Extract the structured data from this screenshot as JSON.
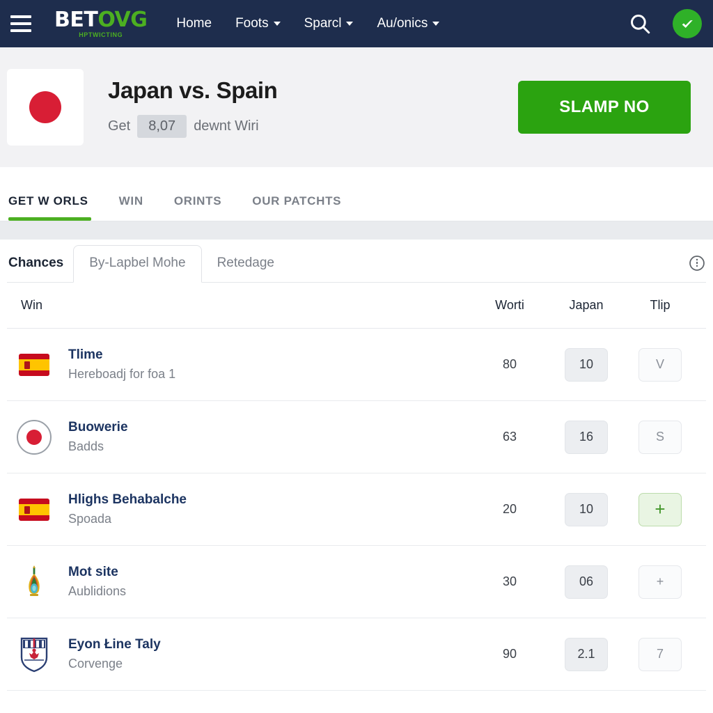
{
  "header": {
    "menu_icon": "hamburger-icon",
    "logo": {
      "primary": "BET",
      "accent": "OVG",
      "tagline": "HPTWICTING"
    },
    "nav": [
      {
        "label": "Home",
        "has_caret": false
      },
      {
        "label": "Foots",
        "has_caret": true
      },
      {
        "label": "Sparcl",
        "has_caret": true
      },
      {
        "label": "Au/onics",
        "has_caret": true
      }
    ],
    "search_icon": "search-icon",
    "avatar_icon": "avatar-check-icon",
    "background": "#1e2d4d"
  },
  "hero": {
    "flag_icon": "japan-flag-icon",
    "title": "Japan vs. Spain",
    "subtitle_prefix": "Get",
    "subtitle_chip": "8,07",
    "subtitle_suffix": "dewnt Wiri",
    "cta_label": "SLAMP NO",
    "cta_color": "#2ba310",
    "background": "#f2f2f4"
  },
  "tabs": [
    {
      "label": "GET W ORLS",
      "active": true
    },
    {
      "label": "WIN",
      "active": false
    },
    {
      "label": "ORINTS",
      "active": false
    },
    {
      "label": "OUR PATCHTS",
      "active": false
    }
  ],
  "panel": {
    "title": "Chances",
    "subtabs": [
      {
        "label": "By-Lapbel Mohe",
        "boxed": true
      },
      {
        "label": "Retedage",
        "boxed": false
      }
    ],
    "info_icon": "info-circle-icon"
  },
  "table": {
    "columns": {
      "name": "Win",
      "worth": "Worti",
      "japan": "Japan",
      "tlip": "Tlip"
    },
    "rows": [
      {
        "icon": "spain-flag-icon",
        "title": "Tlime",
        "subtitle": "Hereboadj for foa 1",
        "worth": "80",
        "japan": "10",
        "japan_style": "grey",
        "tlip": "V",
        "tlip_style": "plain"
      },
      {
        "icon": "japan-flag-circle-icon",
        "title": "Buowerie",
        "subtitle": "Badds",
        "worth": "63",
        "japan": "16",
        "japan_style": "grey",
        "tlip": "S",
        "tlip_style": "plain"
      },
      {
        "icon": "spain-flag-icon",
        "title": "Hlighs Behabalche",
        "subtitle": "Spoada",
        "worth": "20",
        "japan": "10",
        "japan_style": "grey",
        "tlip": "+",
        "tlip_style": "green"
      },
      {
        "icon": "trophy-icon",
        "title": "Mot site",
        "subtitle": "Aublidions",
        "worth": "30",
        "japan": "06",
        "japan_style": "grey",
        "tlip": "+",
        "tlip_style": "plain"
      },
      {
        "icon": "crest-badge-icon",
        "title": "Eyon Łine Taly",
        "subtitle": "Corvenge",
        "worth": "90",
        "japan": "2.1",
        "japan_style": "grey",
        "tlip": "7",
        "tlip_style": "plain"
      }
    ]
  }
}
